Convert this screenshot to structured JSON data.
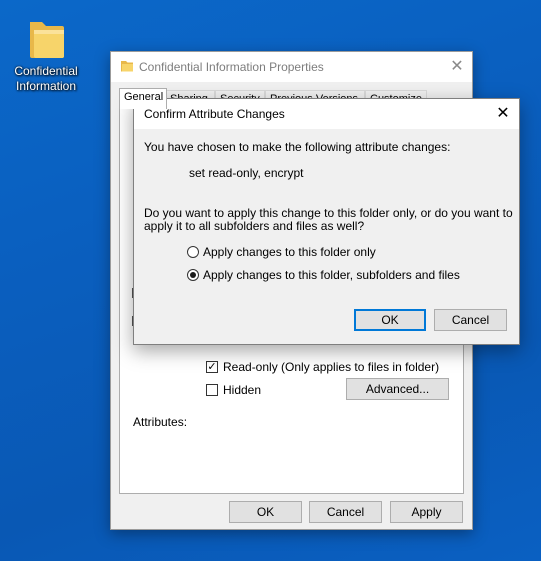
{
  "desktop": {
    "icon_label_line1": "Confidential",
    "icon_label_line2": "Information"
  },
  "properties_window": {
    "title": "Confidential Information Properties",
    "tabs": [
      "General",
      "Sharing",
      "Security",
      "Previous Versions",
      "Customize"
    ],
    "attributes_label": "Attributes:",
    "readonly_label": "Read-only (Only applies to files in folder)",
    "readonly_checked": true,
    "hidden_label": "Hidden",
    "hidden_checked": false,
    "advanced_button": "Advanced...",
    "ok_button": "OK",
    "cancel_button": "Cancel",
    "apply_button": "Apply"
  },
  "dialog": {
    "title": "Confirm Attribute Changes",
    "intro": "You have chosen to make the following attribute changes:",
    "changes": "set read-only, encrypt",
    "question_line1": "Do you want to apply this change to this folder only, or do you want to",
    "question_line2": "apply it to all subfolders and files as well?",
    "options": [
      {
        "label": "Apply changes to this folder only",
        "selected": false
      },
      {
        "label": "Apply changes to this folder, subfolders and files",
        "selected": true
      }
    ],
    "ok_button": "OK",
    "cancel_button": "Cancel"
  },
  "colors": {
    "desktop_bg": "#0a60c2",
    "focus_border": "#0078d7"
  },
  "icons": [
    "folder-icon",
    "close-icon",
    "checkbox-checked-icon"
  ]
}
